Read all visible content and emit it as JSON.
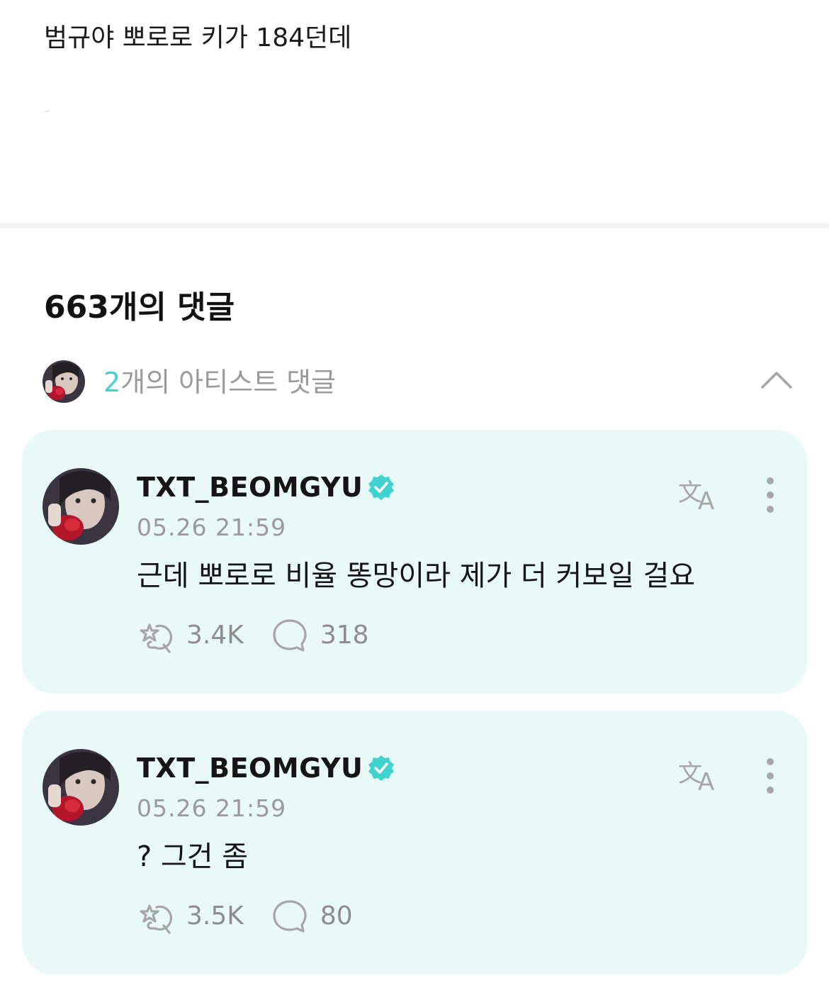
{
  "post": {
    "text": "범규야 뽀로로 키가 184던데"
  },
  "comments_section": {
    "count_label": "663개의 댓글",
    "artist_summary": {
      "count": "2",
      "label": "개의 아티스트 댓글",
      "expanded": true
    }
  },
  "comments": [
    {
      "username": "TXT_BEOMGYU",
      "verified": true,
      "timestamp": "05.26 21:59",
      "text": "근데 뽀로로 비율 똥망이라 제가 더 커보일 걸요",
      "likes": "3.4K",
      "replies": "318"
    },
    {
      "username": "TXT_BEOMGYU",
      "verified": true,
      "timestamp": "05.26 21:59",
      "text": "? 그건 좀",
      "likes": "3.5K",
      "replies": "80"
    }
  ],
  "colors": {
    "accent": "#3fd2cf",
    "card_bg": "#e9f9f7",
    "muted_text": "#9a9a9a",
    "icon_gray": "#a6a6a6"
  },
  "icons": {
    "translate": "translate-icon",
    "more": "more-vertical-icon",
    "like": "like-icon",
    "reply": "reply-bubble-icon",
    "verified": "verified-badge-icon",
    "collapse": "chevron-up-icon"
  }
}
